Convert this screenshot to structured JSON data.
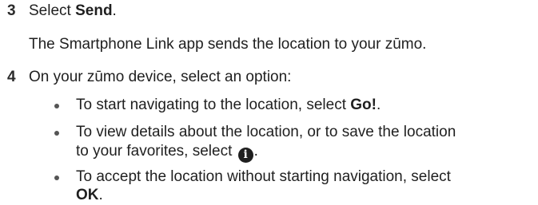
{
  "steps": [
    {
      "number": "3",
      "lead": "Select ",
      "bold": "Send",
      "tail": ".",
      "detail": "The Smartphone Link app sends the location to your zūmo."
    },
    {
      "number": "4",
      "text": "On your zūmo device, select an option:"
    }
  ],
  "bullets": [
    {
      "lead": "To start navigating to the location, select ",
      "bold": "Go!",
      "tail": "."
    },
    {
      "line1": "To view details about the location, or to save the location",
      "line2_lead": "to your favorites, select ",
      "icon": "info-icon",
      "icon_glyph": "i",
      "line2_tail": "."
    },
    {
      "line1": "To accept the location without starting navigation, select",
      "line2_bold": "OK",
      "line2_tail": "."
    }
  ]
}
